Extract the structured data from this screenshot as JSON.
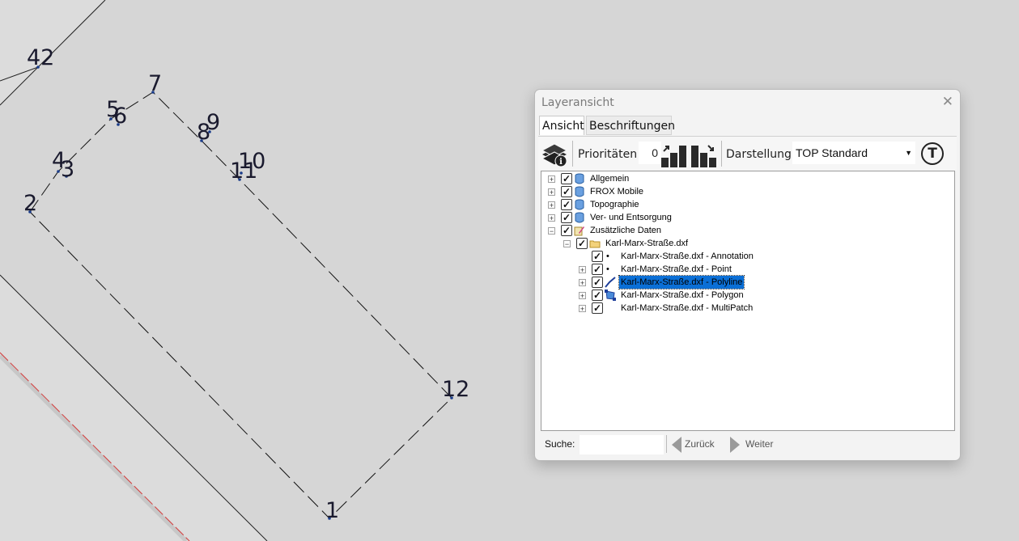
{
  "map": {
    "point_labels": [
      "42",
      "7",
      "5",
      "6",
      "8",
      "9",
      "4",
      "3",
      "10",
      "11",
      "2",
      "12",
      "1"
    ]
  },
  "window": {
    "title": "Layeransicht",
    "close_glyph": "✕",
    "tabs": [
      "Ansicht",
      "Beschriftungen"
    ],
    "toolbar": {
      "prioritaeten_label": "Prioritäten",
      "prioritaeten_value": "0",
      "darstellung_label": "Darstellung",
      "darstellung_value": "TOP Standard",
      "t_button": "T"
    },
    "tree": [
      {
        "label": "Allgemein",
        "icon": "database-icon"
      },
      {
        "label": "FROX Mobile",
        "icon": "database-icon"
      },
      {
        "label": "Topographie",
        "icon": "database-icon"
      },
      {
        "label": "Ver- und Entsorgung",
        "icon": "database-icon"
      },
      {
        "label": "Zusätzliche Daten",
        "icon": "layer-edit-icon"
      },
      {
        "label": "Karl-Marx-Straße.dxf",
        "icon": "folder-icon"
      },
      {
        "label": "Karl-Marx-Straße.dxf - Annotation",
        "icon": "dot-icon"
      },
      {
        "label": "Karl-Marx-Straße.dxf - Point",
        "icon": "dot-icon"
      },
      {
        "label": "Karl-Marx-Straße.dxf - Polyline",
        "icon": "polyline-icon"
      },
      {
        "label": "Karl-Marx-Straße.dxf - Polygon",
        "icon": "polygon-icon"
      },
      {
        "label": "Karl-Marx-Straße.dxf - MultiPatch",
        "icon": "none"
      }
    ],
    "search": {
      "label": "Suche:",
      "value": ""
    },
    "nav": {
      "back": "Zurück",
      "forward": "Weiter"
    }
  },
  "colors": {
    "selection": "#0b6fd6",
    "map_fill": "#d6d6d6",
    "background": "#dcdcdc"
  }
}
